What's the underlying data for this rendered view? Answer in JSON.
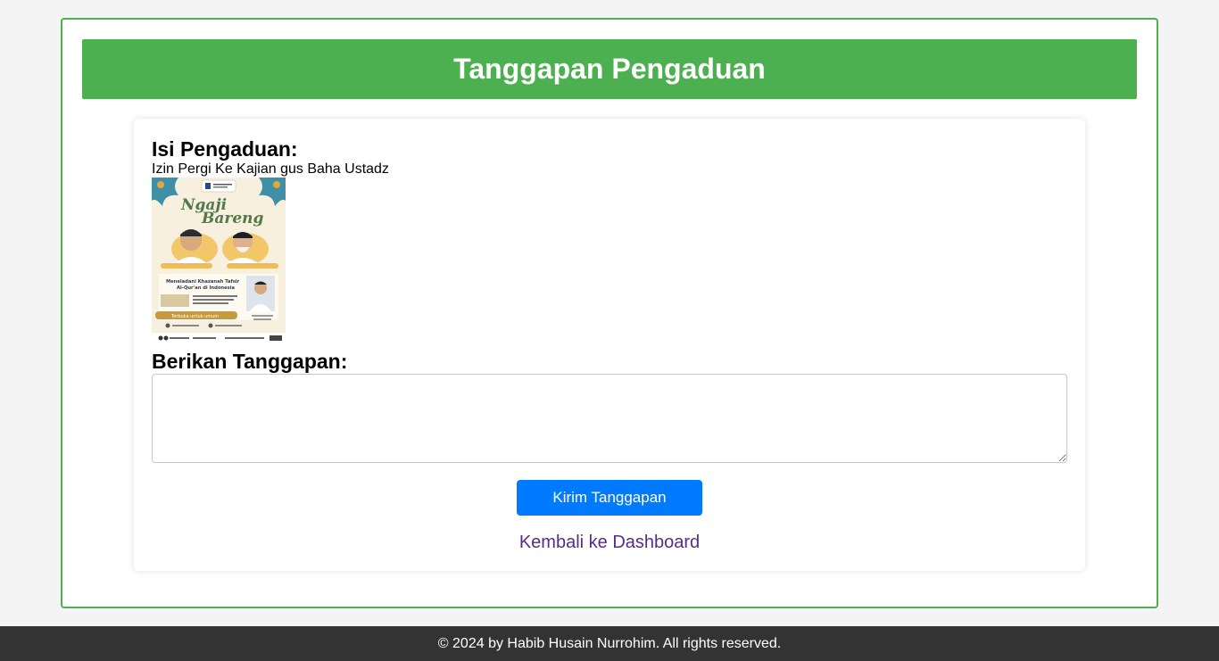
{
  "header": {
    "title": "Tanggapan Pengaduan"
  },
  "complaint": {
    "label": "Isi Pengaduan:",
    "text": "Izin Pergi Ke Kajian gus Baha Ustadz",
    "image": {
      "description_icon": "event-poster-image",
      "title_line1": "Ngaji",
      "title_line2": "Bareng",
      "subtitle_line1": "Meneladani Khazanah Tafsir",
      "subtitle_line2": "Al-Qur'an di Indonesia",
      "badge": "Terbuka untuk umum"
    }
  },
  "response": {
    "label": "Berikan Tanggapan:",
    "value": "",
    "placeholder": ""
  },
  "actions": {
    "submit_label": "Kirim Tanggapan",
    "back_label": "Kembali ke Dashboard"
  },
  "footer": {
    "text": "© 2024 by Habib Husain Nurrohim. All rights reserved."
  },
  "colors": {
    "header_green": "#4caf50",
    "button_blue": "#007bff",
    "link_purple": "#5b2a86",
    "footer_dark": "#333333"
  }
}
